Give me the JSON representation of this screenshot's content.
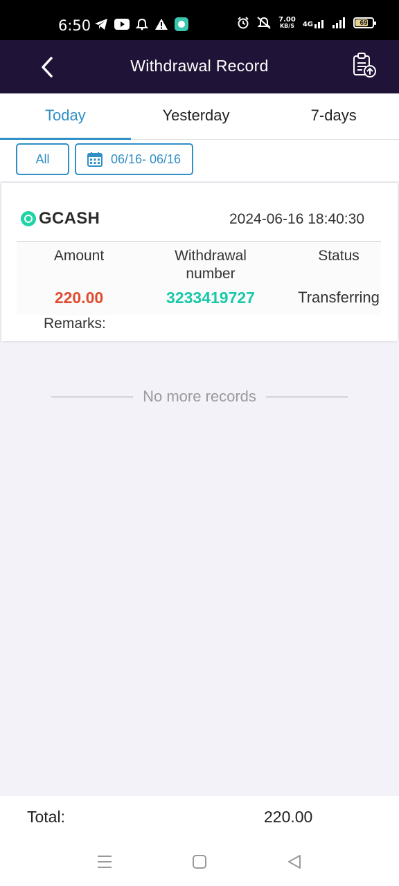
{
  "status_bar": {
    "time": "6:50",
    "speed_value": "7.00",
    "speed_unit": "KB/S",
    "network": "4G",
    "battery": "69"
  },
  "header": {
    "title": "Withdrawal Record"
  },
  "tabs": [
    {
      "label": "Today",
      "active": true
    },
    {
      "label": "Yesterday",
      "active": false
    },
    {
      "label": "7-days",
      "active": false
    }
  ],
  "filters": {
    "type_label": "All",
    "date_range": "06/16- 06/16"
  },
  "record": {
    "method": "GCASH",
    "datetime": "2024-06-16 18:40:30",
    "columns": [
      "Amount",
      "Withdrawal number",
      "Status"
    ],
    "amount": "220.00",
    "withdrawal_number": "3233419727",
    "status": "Transferring",
    "remarks_label": "Remarks:"
  },
  "no_more_text": "No more records",
  "total": {
    "label": "Total:",
    "value": "220.00"
  },
  "colors": {
    "header_bg": "#1f1437",
    "accent": "#2f8fc6",
    "amount": "#e04b2e",
    "withdrawal_number": "#18c9a9",
    "gcash": "#20d3a4"
  }
}
